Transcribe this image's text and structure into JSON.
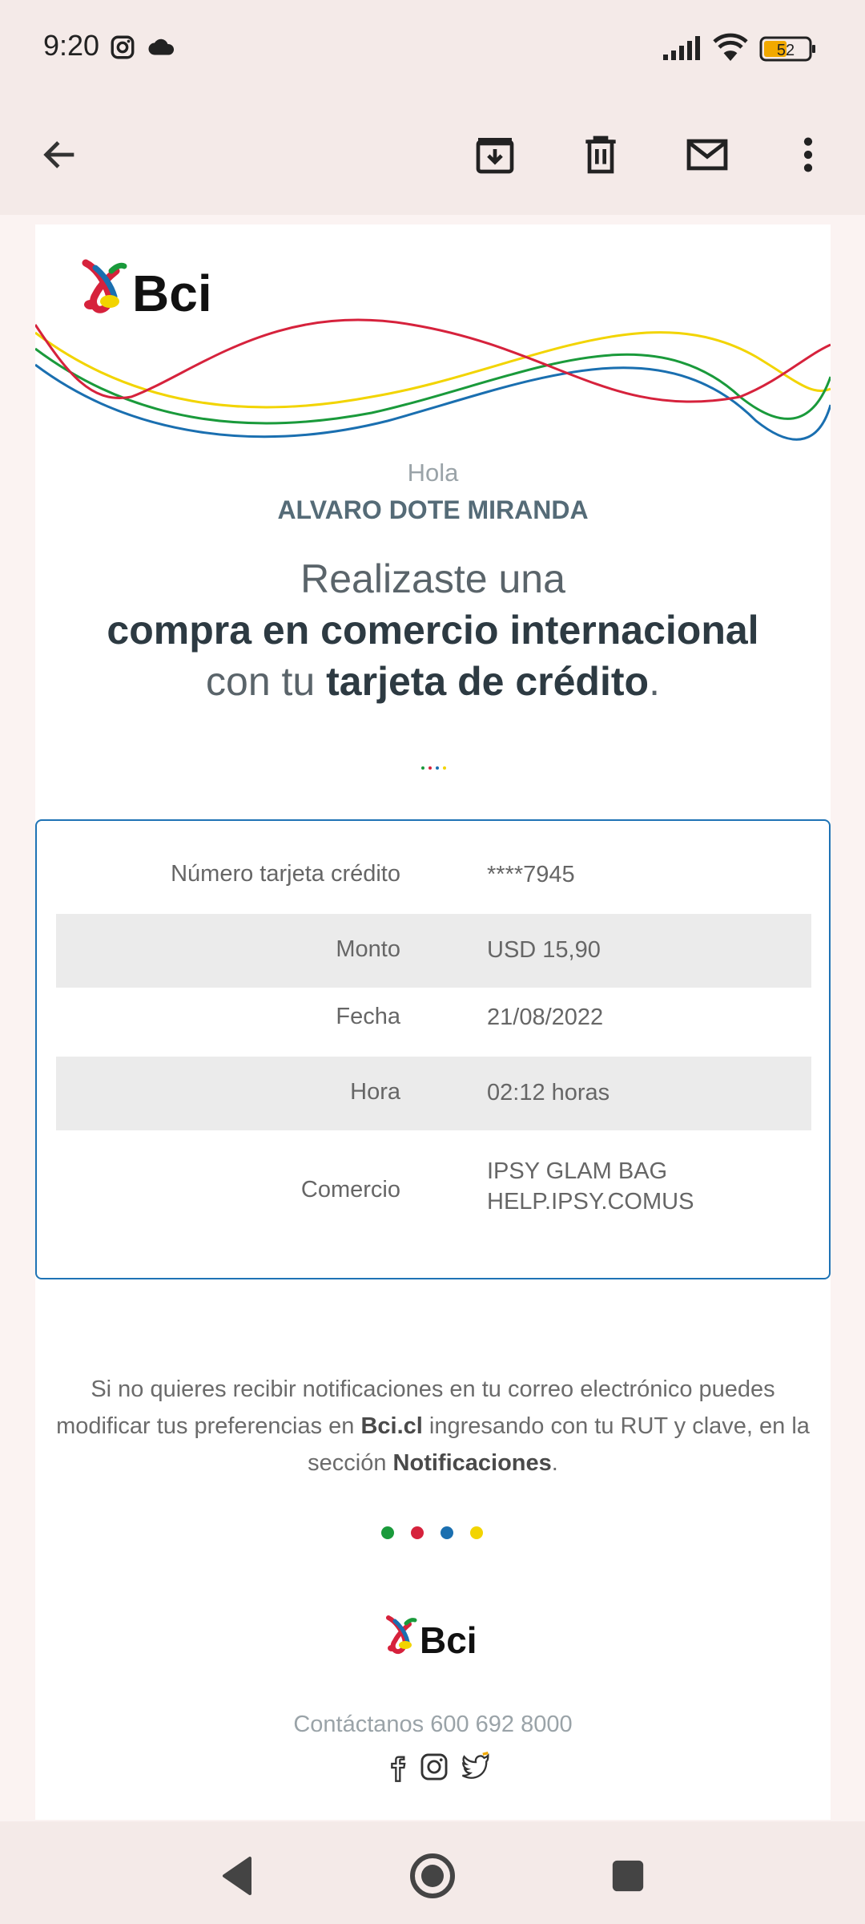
{
  "status_bar": {
    "time": "9:20",
    "battery": "52"
  },
  "app_bar": {
    "back_icon": "arrow-left-icon",
    "actions": [
      "archive-icon",
      "delete-icon",
      "mark-unread-icon",
      "more-vert-icon"
    ]
  },
  "email": {
    "brand": "Bci",
    "greeting": "Hola",
    "recipient": "ALVARO DOTE MIRANDA",
    "headline": {
      "line1": "Realizaste una",
      "line2": "compra en comercio internacional",
      "line3_prefix": "con tu",
      "line3_bold": "tarjeta de crédito",
      "line3_suffix": "."
    },
    "details": [
      {
        "label": "Número tarjeta crédito",
        "value": "****7945"
      },
      {
        "label": "Monto",
        "value": "USD 15,90"
      },
      {
        "label": "Fecha",
        "value": "21/08/2022"
      },
      {
        "label": "Hora",
        "value": "02:12 horas"
      },
      {
        "label": "Comercio",
        "value_line1": "IPSY GLAM BAG",
        "value_line2": "HELP.IPSY.COMUS"
      }
    ],
    "footer": {
      "text1": "Si no quieres recibir notificaciones en tu correo electrónico puedes modificar tus preferencias en",
      "link": "Bci.cl",
      "text2": "ingresando con tu RUT y clave, en la sección",
      "section": "Notificaciones",
      "text3": "."
    },
    "contact": "Contáctanos 600  692  8000",
    "socials": [
      "facebook-icon",
      "instagram-icon",
      "twitter-icon"
    ]
  },
  "colors": {
    "green": "#1a9a3b",
    "red": "#d6223c",
    "blue": "#1a6fb0",
    "yellow": "#f2d400",
    "border": "#1f73b5"
  }
}
